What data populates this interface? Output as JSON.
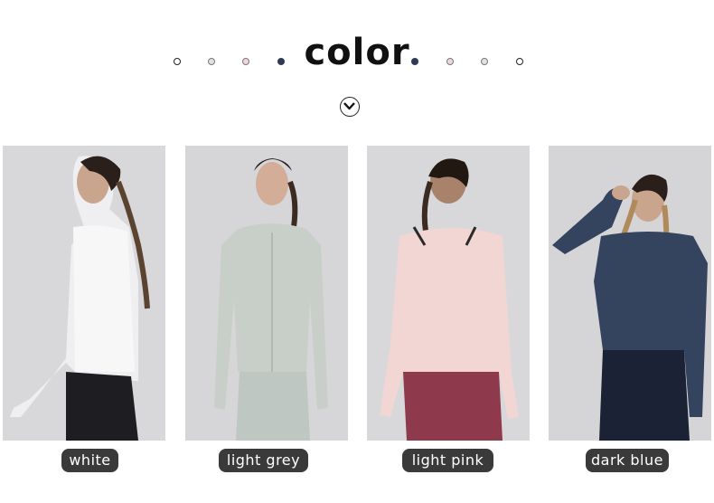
{
  "header": {
    "title": "color"
  },
  "colors": {
    "white": "#ffffff",
    "light_grey": "#c9cccd",
    "light_pink": "#eed4d3",
    "dark_blue": "#2f3b54",
    "label_bg": "#3a3a3a"
  },
  "swatches": [
    {
      "name": "white",
      "label": "white",
      "garment_color": "#f3f4f5",
      "bg": "#d8d8da"
    },
    {
      "name": "light-grey",
      "label": "light grey",
      "garment_color": "#c7cfc8",
      "bg": "#d6d6d8"
    },
    {
      "name": "light-pink",
      "label": "light pink",
      "garment_color": "#f1d6d3",
      "bg": "#d8d8da"
    },
    {
      "name": "dark-blue",
      "label": "dark blue",
      "garment_color": "#34435e",
      "bg": "#d5d5d7"
    }
  ],
  "icons": {
    "scroll": "chevron-down-icon"
  }
}
